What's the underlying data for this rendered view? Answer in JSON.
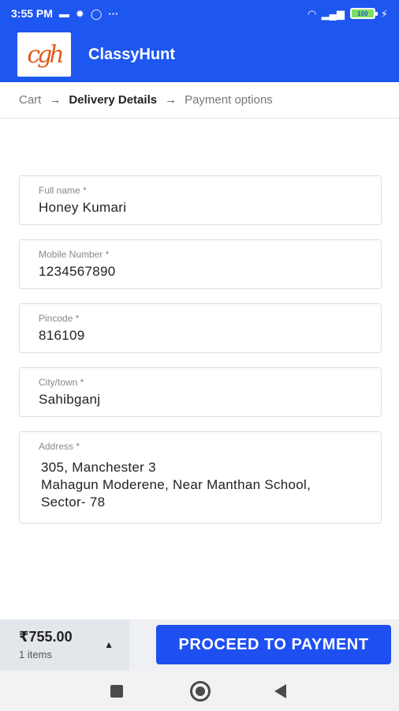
{
  "status_bar": {
    "time": "3:55 PM",
    "battery": "100"
  },
  "header": {
    "logo_text": "cgh",
    "title": "ClassyHunt"
  },
  "breadcrumb": {
    "items": [
      "Cart",
      "Delivery Details",
      "Payment options"
    ],
    "separator": "→",
    "active_index": 1
  },
  "form": {
    "full_name": {
      "label": "Full name *",
      "value": "Honey Kumari"
    },
    "mobile": {
      "label": "Mobile Number *",
      "value": "1234567890"
    },
    "pincode": {
      "label": "Pincode *",
      "value": "816109"
    },
    "city": {
      "label": "City/town *",
      "value": "Sahibganj"
    },
    "address": {
      "label": "Address *",
      "lines": [
        "305, Manchester 3",
        "Mahagun Moderene, Near Manthan School,",
        "Sector- 78"
      ]
    }
  },
  "checkout": {
    "total": "₹755.00",
    "items": "1 items",
    "proceed_label": "PROCEED TO PAYMENT"
  },
  "colors": {
    "brand_blue": "#1e56f0",
    "button_blue": "#1e4ff0"
  }
}
